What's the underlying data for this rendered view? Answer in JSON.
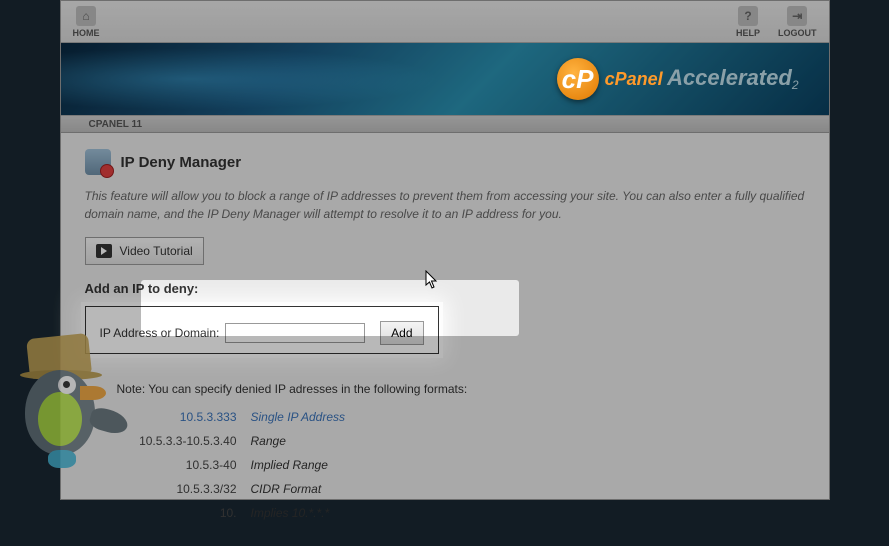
{
  "topbar": {
    "home": "HOME",
    "help": "HELP",
    "logout": "LOGOUT"
  },
  "brand": {
    "cp": "cPanel",
    "acc": "Accelerated",
    "sub": "2"
  },
  "crumb": "CPANEL 11",
  "page": {
    "title": "IP Deny Manager",
    "description": "This feature will allow you to block a range of IP addresses to prevent them from accessing your site. You can also enter a fully qualified domain name, and the IP Deny Manager will attempt to resolve it to an IP address for you."
  },
  "video_btn": "Video Tutorial",
  "section": "Add an IP to deny:",
  "form": {
    "label": "IP Address or Domain:",
    "value": "",
    "add": "Add"
  },
  "note": "Note: You can specify denied IP adresses in the following formats:",
  "formats": [
    {
      "ex": "10.5.3.333",
      "lbl": "Single IP Address"
    },
    {
      "ex": "10.5.3.3-10.5.3.40",
      "lbl": "Range"
    },
    {
      "ex": "10.5.3-40",
      "lbl": "Implied Range"
    },
    {
      "ex": "10.5.3.3/32",
      "lbl": "CIDR Format"
    },
    {
      "ex": "10.",
      "lbl": "Implies 10.*.*.*"
    }
  ]
}
